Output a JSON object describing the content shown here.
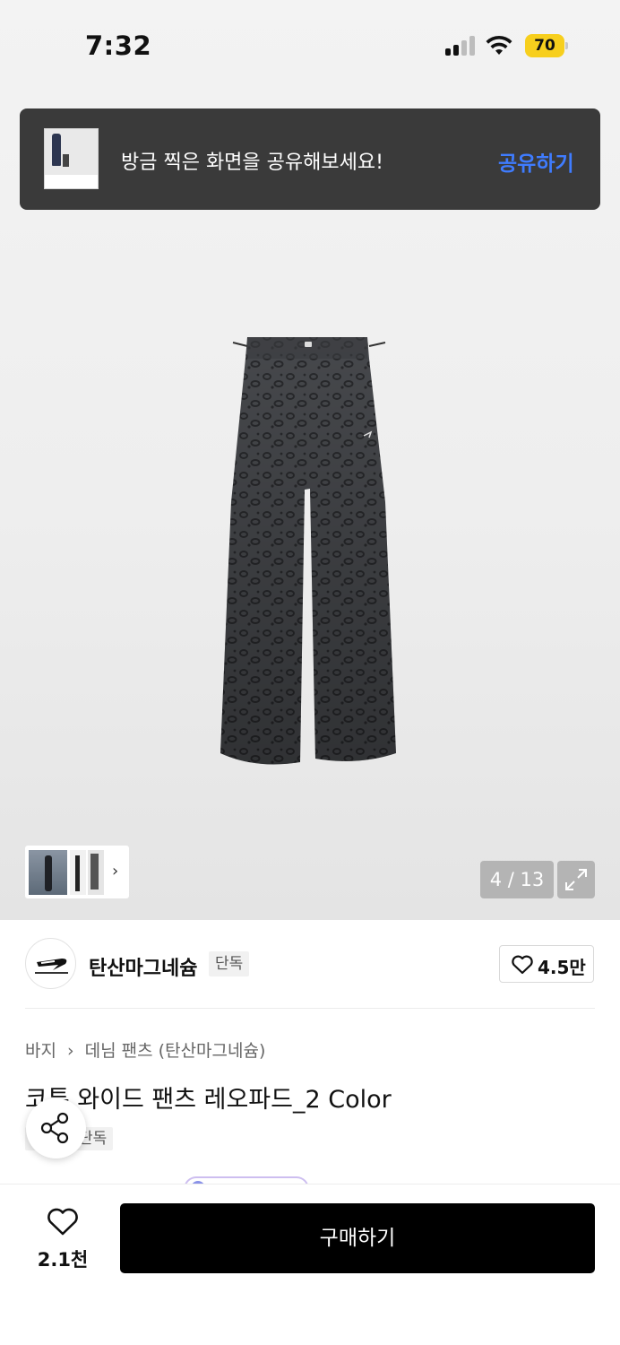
{
  "status_bar": {
    "time": "7:32",
    "battery": "70"
  },
  "share_toast": {
    "message": "방금 찍은 화면을 공유해보세요!",
    "action_label": "공유하기"
  },
  "gallery": {
    "page_counter": "4 / 13"
  },
  "brand": {
    "name": "탄산마그네슘",
    "exclusive_tag": "단독",
    "like_count": "4.5만"
  },
  "breadcrumb": {
    "category": "바지",
    "subcategory": "데님 팬츠 (탄산마그네슘)"
  },
  "product": {
    "title": "코튼 와이드 팬츠 레오파드_2 Color",
    "tag": "단독"
  },
  "bottom_bar": {
    "wish_count": "2.1천",
    "buy_label": "구매하기"
  },
  "colors": {
    "accent": "#3f7cff",
    "toast_bg": "#3a3a3a",
    "battery": "#f7cf1d",
    "buy_bg": "#000000"
  }
}
